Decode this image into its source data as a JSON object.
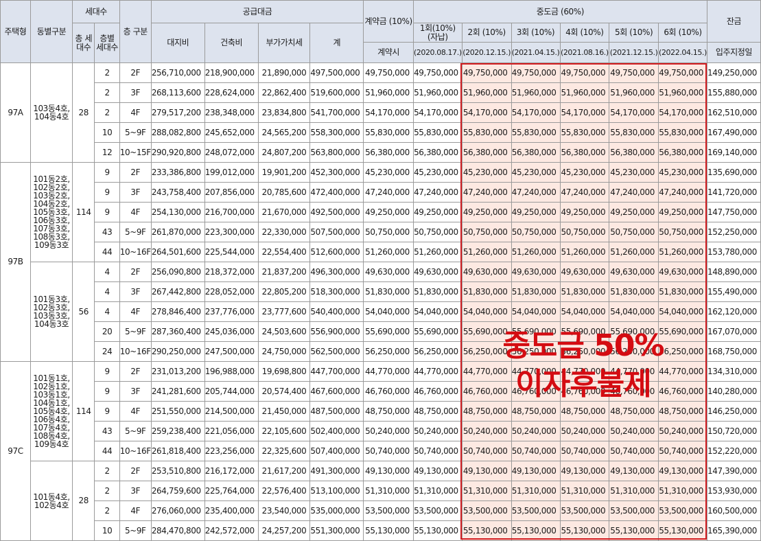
{
  "header": {
    "house_type": "주택형",
    "building": "동별구분",
    "units": "세대수",
    "total_units": "총 세대수",
    "floor_units": "층별 세대수",
    "floor": "층 구분",
    "supply_price": "공급대금",
    "land": "대지비",
    "construction": "건축비",
    "vat": "부가가치세",
    "total": "계",
    "deposit": "계약금 (10%)",
    "deposit_time": "계약시",
    "middle": "중도금 (60%)",
    "m1": "1회(10%) (자납)",
    "m2": "2회 (10%)",
    "m3": "3회 (10%)",
    "m4": "4회 (10%)",
    "m5": "5회 (10%)",
    "m6": "6회 (10%)",
    "d1": "(2020.08.17.)",
    "d2": "(2020.12.15.)",
    "d3": "(2021.04.15.)",
    "d4": "(2021.08.16.)",
    "d5": "(2021.12.15.)",
    "d6": "(2022.04.15.)",
    "balance": "잔금",
    "balance_time": "입주지정일"
  },
  "types": [
    {
      "name": "97A"
    },
    {
      "name": "97B"
    },
    {
      "name": "97C"
    }
  ],
  "groups": [
    {
      "buildings": "103동4호, 104동4호",
      "total": "28"
    },
    {
      "buildings": "101동2호, 102동2호, 103동2호, 104동2호, 105동3호, 106동3호, 107동3호, 108동3호, 109동3호",
      "total": "114"
    },
    {
      "buildings": "101동3호, 102동3호, 103동3호, 104동3호",
      "total": "56"
    },
    {
      "buildings": "101동1호, 102동1호, 103동1호, 104동1호, 105동4호, 106동4호, 107동4호, 108동4호, 109동4호",
      "total": "114"
    },
    {
      "buildings": "101동4호, 102동4호",
      "total": "28"
    }
  ],
  "rows": [
    {
      "u": "2",
      "f": "2F",
      "land": "256,710,000",
      "cons": "218,900,000",
      "vat": "21,890,000",
      "tot": "497,500,000",
      "dep": "49,750,000",
      "m": "49,750,000",
      "bal": "149,250,000"
    },
    {
      "u": "2",
      "f": "3F",
      "land": "268,113,600",
      "cons": "228,624,000",
      "vat": "22,862,400",
      "tot": "519,600,000",
      "dep": "51,960,000",
      "m": "51,960,000",
      "bal": "155,880,000"
    },
    {
      "u": "2",
      "f": "4F",
      "land": "279,517,200",
      "cons": "238,348,000",
      "vat": "23,834,800",
      "tot": "541,700,000",
      "dep": "54,170,000",
      "m": "54,170,000",
      "bal": "162,510,000"
    },
    {
      "u": "10",
      "f": "5~9F",
      "land": "288,082,800",
      "cons": "245,652,000",
      "vat": "24,565,200",
      "tot": "558,300,000",
      "dep": "55,830,000",
      "m": "55,830,000",
      "bal": "167,490,000"
    },
    {
      "u": "12",
      "f": "10~15F",
      "land": "290,920,800",
      "cons": "248,072,000",
      "vat": "24,807,200",
      "tot": "563,800,000",
      "dep": "56,380,000",
      "m": "56,380,000",
      "bal": "169,140,000"
    },
    {
      "u": "9",
      "f": "2F",
      "land": "233,386,800",
      "cons": "199,012,000",
      "vat": "19,901,200",
      "tot": "452,300,000",
      "dep": "45,230,000",
      "m": "45,230,000",
      "bal": "135,690,000"
    },
    {
      "u": "9",
      "f": "3F",
      "land": "243,758,400",
      "cons": "207,856,000",
      "vat": "20,785,600",
      "tot": "472,400,000",
      "dep": "47,240,000",
      "m": "47,240,000",
      "bal": "141,720,000"
    },
    {
      "u": "9",
      "f": "4F",
      "land": "254,130,000",
      "cons": "216,700,000",
      "vat": "21,670,000",
      "tot": "492,500,000",
      "dep": "49,250,000",
      "m": "49,250,000",
      "bal": "147,750,000"
    },
    {
      "u": "43",
      "f": "5~9F",
      "land": "261,870,000",
      "cons": "223,300,000",
      "vat": "22,330,000",
      "tot": "507,500,000",
      "dep": "50,750,000",
      "m": "50,750,000",
      "bal": "152,250,000"
    },
    {
      "u": "44",
      "f": "10~16F",
      "land": "264,501,600",
      "cons": "225,544,000",
      "vat": "22,554,400",
      "tot": "512,600,000",
      "dep": "51,260,000",
      "m": "51,260,000",
      "bal": "153,780,000"
    },
    {
      "u": "4",
      "f": "2F",
      "land": "256,090,800",
      "cons": "218,372,000",
      "vat": "21,837,200",
      "tot": "496,300,000",
      "dep": "49,630,000",
      "m": "49,630,000",
      "bal": "148,890,000"
    },
    {
      "u": "4",
      "f": "3F",
      "land": "267,442,800",
      "cons": "228,052,000",
      "vat": "22,805,200",
      "tot": "518,300,000",
      "dep": "51,830,000",
      "m": "51,830,000",
      "bal": "155,490,000"
    },
    {
      "u": "4",
      "f": "4F",
      "land": "278,846,400",
      "cons": "237,776,000",
      "vat": "23,777,600",
      "tot": "540,400,000",
      "dep": "54,040,000",
      "m": "54,040,000",
      "bal": "162,120,000"
    },
    {
      "u": "20",
      "f": "5~9F",
      "land": "287,360,400",
      "cons": "245,036,000",
      "vat": "24,503,600",
      "tot": "556,900,000",
      "dep": "55,690,000",
      "m": "55,690,000",
      "bal": "167,070,000"
    },
    {
      "u": "24",
      "f": "10~16F",
      "land": "290,250,000",
      "cons": "247,500,000",
      "vat": "24,750,000",
      "tot": "562,500,000",
      "dep": "56,250,000",
      "m": "56,250,000",
      "bal": "168,750,000"
    },
    {
      "u": "9",
      "f": "2F",
      "land": "231,013,200",
      "cons": "196,988,000",
      "vat": "19,698,800",
      "tot": "447,700,000",
      "dep": "44,770,000",
      "m": "44,770,000",
      "bal": "134,310,000"
    },
    {
      "u": "9",
      "f": "3F",
      "land": "241,281,600",
      "cons": "205,744,000",
      "vat": "20,574,400",
      "tot": "467,600,000",
      "dep": "46,760,000",
      "m": "46,760,000",
      "bal": "140,280,000"
    },
    {
      "u": "9",
      "f": "4F",
      "land": "251,550,000",
      "cons": "214,500,000",
      "vat": "21,450,000",
      "tot": "487,500,000",
      "dep": "48,750,000",
      "m": "48,750,000",
      "bal": "146,250,000"
    },
    {
      "u": "43",
      "f": "5~9F",
      "land": "259,238,400",
      "cons": "221,056,000",
      "vat": "22,105,600",
      "tot": "502,400,000",
      "dep": "50,240,000",
      "m": "50,240,000",
      "bal": "150,720,000"
    },
    {
      "u": "44",
      "f": "10~16F",
      "land": "261,818,400",
      "cons": "223,256,000",
      "vat": "22,325,600",
      "tot": "507,400,000",
      "dep": "50,740,000",
      "m": "50,740,000",
      "bal": "152,220,000"
    },
    {
      "u": "2",
      "f": "2F",
      "land": "253,510,800",
      "cons": "216,172,000",
      "vat": "21,617,200",
      "tot": "491,300,000",
      "dep": "49,130,000",
      "m": "49,130,000",
      "bal": "147,390,000"
    },
    {
      "u": "2",
      "f": "3F",
      "land": "264,759,600",
      "cons": "225,764,000",
      "vat": "22,576,400",
      "tot": "513,100,000",
      "dep": "51,310,000",
      "m": "51,310,000",
      "bal": "153,930,000"
    },
    {
      "u": "2",
      "f": "4F",
      "land": "276,060,000",
      "cons": "235,400,000",
      "vat": "23,540,000",
      "tot": "535,000,000",
      "dep": "53,500,000",
      "m": "53,500,000",
      "bal": "160,500,000"
    },
    {
      "u": "10",
      "f": "5~9F",
      "land": "284,470,800",
      "cons": "242,572,000",
      "vat": "24,257,200",
      "tot": "551,300,000",
      "dep": "55,130,000",
      "m": "55,130,000",
      "bal": "165,390,000"
    }
  ],
  "overlay": {
    "line1": "중도금 50%",
    "line2": "이자후불제"
  },
  "colors": {
    "header_bg": "#dde3ee",
    "highlight_bg": "#fde9e2",
    "highlight_border": "#d21c20",
    "overlay_text": "#d40c12"
  }
}
